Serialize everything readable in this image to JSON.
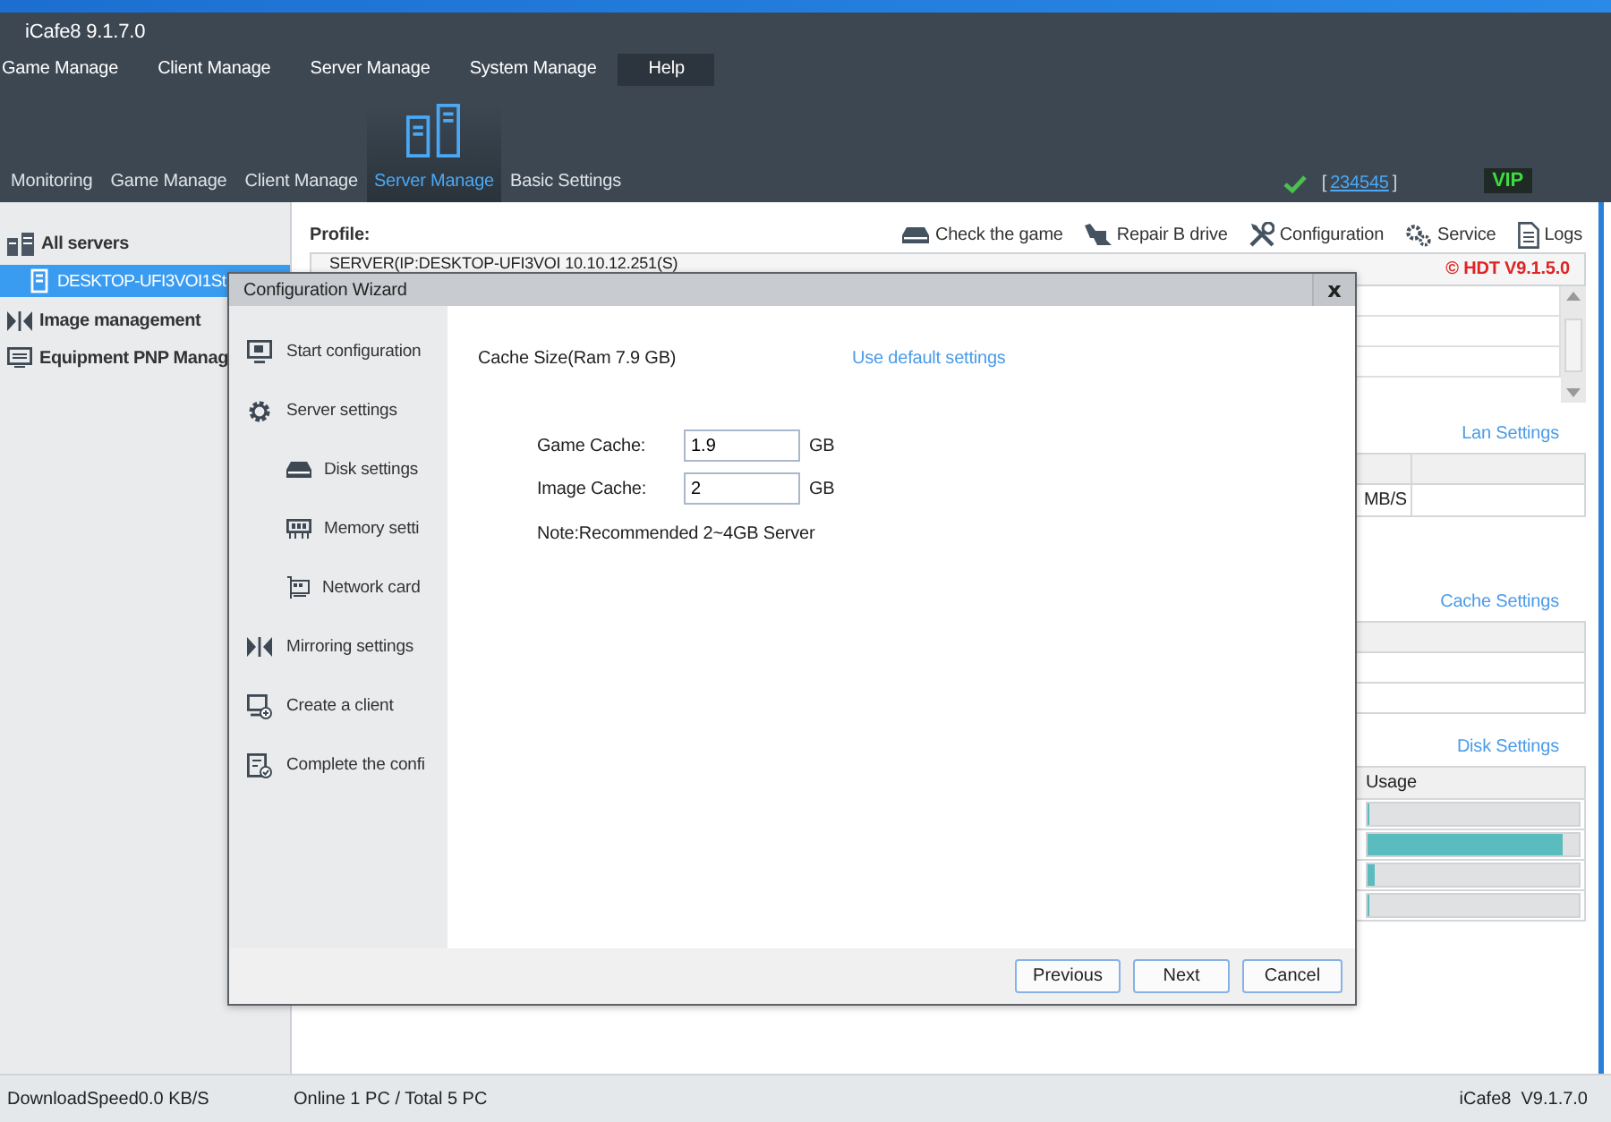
{
  "window": {
    "title": "iCafe8 9.1.7.0"
  },
  "menu": [
    {
      "label": "Game Manage",
      "selected": false
    },
    {
      "label": "Client Manage",
      "selected": false
    },
    {
      "label": "Server Manage",
      "selected": false
    },
    {
      "label": "System Manage",
      "selected": false
    },
    {
      "label": "Help",
      "selected": true
    }
  ],
  "tabs": [
    {
      "label": "Monitoring",
      "selected": false
    },
    {
      "label": "Game Manage",
      "selected": false
    },
    {
      "label": "Client Manage",
      "selected": false
    },
    {
      "label": "Server Manage",
      "selected": true
    },
    {
      "label": "Basic Settings",
      "selected": false
    }
  ],
  "account": {
    "verified": true,
    "bracket_open": "[",
    "id": "234545",
    "bracket_close": "]",
    "vip": "VIP"
  },
  "sidebar": {
    "items": [
      {
        "label": "All servers",
        "kind": "servers",
        "children": [
          {
            "label": "DESKTOP-UFI3VOI1St",
            "selected": true
          }
        ]
      },
      {
        "label": "Image management",
        "kind": "images"
      },
      {
        "label": "Equipment PNP Manag",
        "kind": "equipment"
      }
    ]
  },
  "profile": {
    "label": "Profile:",
    "toolbar": [
      {
        "label": "Check the game",
        "kind": "disk"
      },
      {
        "label": "Repair B drive",
        "kind": "repair"
      },
      {
        "label": "Configuration",
        "kind": "tools"
      },
      {
        "label": "Service",
        "kind": "gears"
      },
      {
        "label": "Logs",
        "kind": "doc"
      }
    ],
    "server": "SERVER(IP:DESKTOP-UFI3VOI 10.10.12.251(S)",
    "version": "© HDT V9.1.5.0"
  },
  "lan": {
    "title": "Lan Settings",
    "cell": "MB/S"
  },
  "cache": {
    "title": "Cache Settings"
  },
  "disk": {
    "title": "Disk Settings",
    "column": "Usage",
    "rows": [
      {
        "level": 0
      },
      {
        "level": 0.92
      },
      {
        "level": 0.03
      },
      {
        "level": 0
      }
    ]
  },
  "dialog": {
    "title": "Configuration Wizard",
    "close": "x",
    "steps": [
      {
        "label": "Start configuration",
        "kind": "start"
      },
      {
        "label": "Server settings",
        "kind": "server",
        "children": [
          {
            "label": "Disk settings",
            "kind": "disk"
          },
          {
            "label": "Memory setti",
            "kind": "memory"
          },
          {
            "label": "Network card",
            "kind": "network"
          }
        ]
      },
      {
        "label": "Mirroring settings",
        "kind": "mirror"
      },
      {
        "label": "Create a client",
        "kind": "client"
      },
      {
        "label": "Complete the confi",
        "kind": "complete"
      }
    ],
    "heading": "Cache Size(Ram 7.9 GB)",
    "link": "Use default settings",
    "fields": [
      {
        "label": "Game Cache:",
        "value": "1.9",
        "unit": "GB"
      },
      {
        "label": "Image Cache:",
        "value": "2",
        "unit": "GB"
      }
    ],
    "note": "Note:Recommended 2~4GB Server",
    "buttons": [
      "Previous",
      "Next",
      "Cancel"
    ]
  },
  "status_bar": {
    "download": "DownloadSpeed0.0 KB/S",
    "online": "Online 1 PC / Total 5 PC",
    "version": "iCafe8  V9.1.7.0"
  }
}
